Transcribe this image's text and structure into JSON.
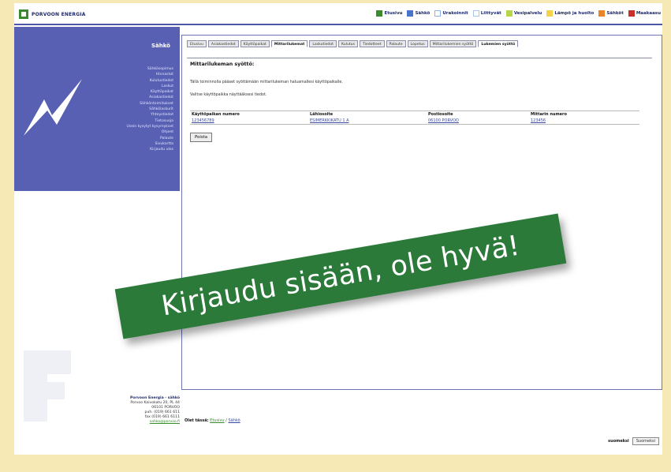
{
  "header": {
    "brand": "PORVOON ENERGIA",
    "nav": [
      {
        "label": "Etusivu",
        "icon": "square-green",
        "color": "#3a8b2e"
      },
      {
        "label": "Sähkö",
        "icon": "square-blue",
        "color": "#4a74c9"
      },
      {
        "label": "Urakoinnit",
        "icon": "square-lightblue",
        "color": "#8fb3e8"
      },
      {
        "label": "Liittyvät",
        "icon": "square-lightblue",
        "color": "#a9c4f0"
      },
      {
        "label": "Vesipalvelu",
        "icon": "square-lime",
        "color": "#b6d64a"
      },
      {
        "label": "Lämpö ja huolto",
        "icon": "square-yellow",
        "color": "#f2d34a"
      },
      {
        "label": "Sähköt",
        "icon": "square-orange",
        "color": "#e8852a"
      },
      {
        "label": "Maakaasu",
        "icon": "square-red",
        "color": "#c8302b"
      }
    ]
  },
  "sidebar": {
    "title": "Sähkö",
    "items": [
      "Sähkösopimus",
      "Hinnastot",
      "Kulutustiedot",
      "Laskut",
      "Käyttöpaikat",
      "Asiakastiedot",
      "Sähköntoimitukset",
      "Sähkölaskurit",
      "Yhteystiedot",
      "Tietosuoja",
      "Usein kysytyt kysymykset",
      "Ohjeet",
      "Palaute",
      "Sivukartta",
      "Kirjaudu ulos"
    ],
    "icon": "lightning-bolt-icon"
  },
  "contact": {
    "name": "Porvoon Energia - sähkö",
    "street": "Porvoo Kaivokatu 20, PL 44",
    "city": "06101 PORVOO",
    "phone": "puh. (019) 661 611",
    "fax": "fax (019) 661 6111",
    "email": "sahko@porvoo.fi"
  },
  "main": {
    "tabs": [
      {
        "label": "Etusivu",
        "active": false
      },
      {
        "label": "Asiakastiedot",
        "active": false
      },
      {
        "label": "Käyttöpaikat",
        "active": false
      },
      {
        "label": "Mittarilukemat",
        "active": true
      },
      {
        "label": "Laskutiedot",
        "active": false
      },
      {
        "label": "Kulutus",
        "active": false
      },
      {
        "label": "Tiedotteet",
        "active": false
      },
      {
        "label": "Palaute",
        "active": false
      },
      {
        "label": "Lopetus",
        "active": false
      },
      {
        "label": "Mittarilukemien syöttö",
        "active": false
      },
      {
        "label": "Lukemien syöttö",
        "active": true
      }
    ],
    "title": "Mittarilukeman syöttö:",
    "info": "Tällä toiminnolla pääset syöttämään mittarilukeman haluamallesi käyttöpaikalle.",
    "info2": "Valitse käyttöpaikka näyttääksesi tiedot.",
    "table": {
      "headers": [
        "Käyttöpaikan numero",
        "Lähiosoite",
        "Postiosoite",
        "Mittarin numero"
      ],
      "rows": [
        [
          "123456789",
          "ESIMERKKIKATU 1 A",
          "06100 PORVOO",
          "123456"
        ]
      ]
    },
    "delete_button": "Poista"
  },
  "footer": {
    "label": "Olet tässä:",
    "crumb1": "Etusivu",
    "sep": " / ",
    "crumb2": "Sähkö"
  },
  "language": {
    "label": "suomeksi",
    "selected": "Suomeksi"
  },
  "banner": {
    "text": "Kirjaudu sisään, ole hyvä!",
    "color": "#2b7a3a"
  }
}
